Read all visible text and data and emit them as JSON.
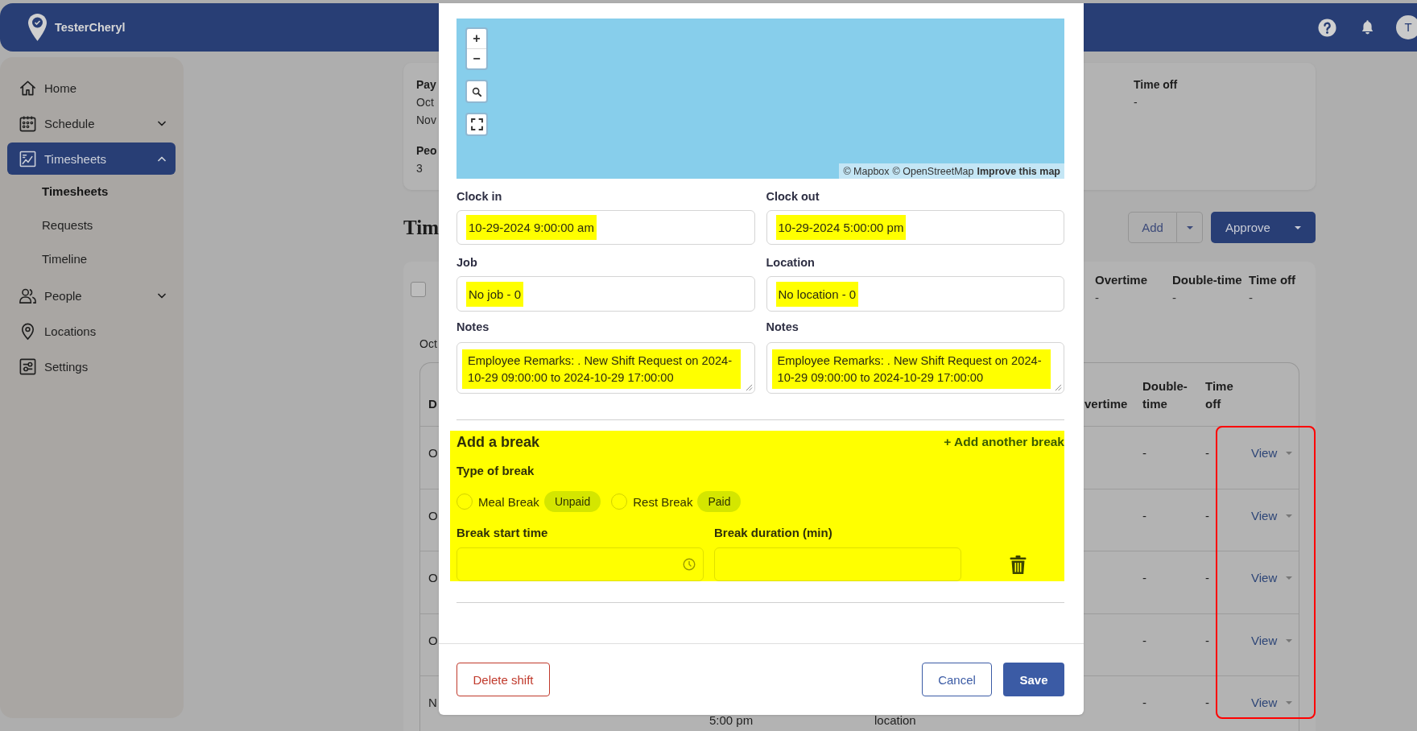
{
  "header": {
    "brand": "TesterCheryl",
    "avatar": "T"
  },
  "sidebar": {
    "items": [
      {
        "label": "Home",
        "kind": "link",
        "selected": false
      },
      {
        "label": "Schedule",
        "kind": "group",
        "selected": false,
        "expanded": false
      },
      {
        "label": "Timesheets",
        "kind": "group",
        "selected": true,
        "expanded": true,
        "children": [
          {
            "label": "Timesheets",
            "selected": true
          },
          {
            "label": "Requests",
            "selected": false
          },
          {
            "label": "Timeline",
            "selected": false
          }
        ]
      },
      {
        "label": "People",
        "kind": "group",
        "selected": false,
        "expanded": false
      },
      {
        "label": "Locations",
        "kind": "link",
        "selected": false
      },
      {
        "label": "Settings",
        "kind": "link",
        "selected": false
      }
    ]
  },
  "summary": {
    "left": [
      {
        "label": "Pay",
        "values": [
          "Oct",
          "Nov"
        ]
      },
      {
        "label": "Peo",
        "values": [
          "3"
        ]
      }
    ],
    "right": [
      {
        "label": "Time off",
        "values": [
          "-"
        ]
      }
    ]
  },
  "page_title": "Tim",
  "actions": {
    "add": "Add",
    "approve": "Approve"
  },
  "totals": {
    "checked": false,
    "columns": [
      {
        "label": "Overtime",
        "value": "-"
      },
      {
        "label": "Double-time",
        "value": "-"
      },
      {
        "label": "Time off",
        "value": "-"
      }
    ]
  },
  "group_label": "Oct",
  "table": {
    "annotation_frame": true,
    "columns": {
      "column_1": "D",
      "overtime": "vertime",
      "double_time": "Double-time",
      "time_off": "Time off"
    },
    "rows": [
      {
        "column_1": "O",
        "double_time": "-",
        "time_off": "-",
        "action": "View"
      },
      {
        "column_1": "O",
        "double_time": "-",
        "time_off": "-",
        "action": "View"
      },
      {
        "column_1": "O",
        "double_time": "-",
        "time_off": "-",
        "action": "View"
      },
      {
        "column_1": "O",
        "double_time": "-",
        "time_off": "-",
        "action": "View"
      },
      {
        "column_1": "N",
        "column_3": "5:00 pm",
        "column_4": "location",
        "double_time": "-",
        "time_off": "-",
        "action": "View"
      }
    ]
  },
  "modal": {
    "map": {
      "zoom_in": "+",
      "zoom_out": "−",
      "attribution": [
        {
          "text": "© Mapbox",
          "kind": "credit"
        },
        {
          "text": "© OpenStreetMap",
          "kind": "credit"
        },
        {
          "text": "Improve this map",
          "kind": "feedback"
        }
      ]
    },
    "fields": [
      {
        "label": "Clock in",
        "kind": "datetime",
        "value": "10-29-2024 9:00:00 am",
        "highlighted": true
      },
      {
        "label": "Clock out",
        "kind": "datetime",
        "value": "10-29-2024 5:00:00 pm",
        "highlighted": true
      },
      {
        "label": "Job",
        "kind": "text",
        "value": "No job - 0",
        "highlighted": true
      },
      {
        "label": "Location",
        "kind": "text",
        "value": "No location - 0",
        "highlighted": true
      },
      {
        "label": "Notes",
        "kind": "textarea",
        "value": "Employee Remarks: . New Shift Request on 2024-10-29 09:00:00 to 2024-10-29 17:00:00",
        "highlighted": true
      },
      {
        "label": "Notes",
        "kind": "textarea",
        "value": "Employee Remarks: . New Shift Request on 2024-10-29 09:00:00 to 2024-10-29 17:00:00",
        "highlighted": true
      }
    ],
    "break": {
      "highlighted": true,
      "title": "Add a break",
      "add_link": "+ Add another break",
      "type_label": "Type of break",
      "types": [
        {
          "label": "Meal Break",
          "tag": "Unpaid",
          "selected": false
        },
        {
          "label": "Rest Break",
          "tag": "Paid",
          "selected": false
        }
      ],
      "start_label": "Break start time",
      "duration_label": "Break duration (min)"
    },
    "footer": {
      "delete": "Delete shift",
      "cancel": "Cancel",
      "save": "Save"
    }
  }
}
